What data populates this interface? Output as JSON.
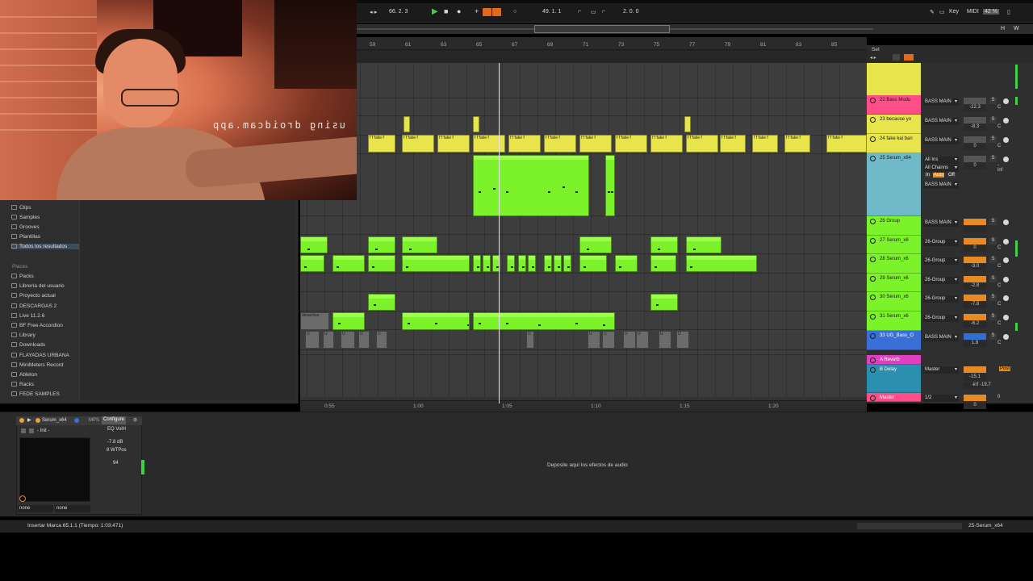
{
  "webcam": {
    "overlay_text": "using droidcam.app"
  },
  "transport": {
    "tempo": "66. 2. 3",
    "position": "49. 1. 1",
    "loop_length": "2. 0. 0",
    "key_label": "Key",
    "midi_label": "MIDI",
    "cpu": "42 %",
    "hw_label": "H",
    "w_label": "W",
    "set_label": "Set"
  },
  "ruler": {
    "bars": [
      "59",
      "61",
      "63",
      "65",
      "67",
      "69",
      "71",
      "73",
      "75",
      "77",
      "79",
      "81",
      "83",
      "85"
    ]
  },
  "time_ruler": {
    "labels": [
      "0:55",
      "1:00",
      "1:05",
      "1:10",
      "1:15",
      "1:20"
    ]
  },
  "browser": {
    "categories": [
      "Clips",
      "Samples",
      "Grooves",
      "Plantillas",
      "Todos los resultados"
    ],
    "places_header": "Places",
    "places": [
      "Packs",
      "Librería del usuario",
      "Proyecto actual",
      "DESCARGAS 2",
      "Live 11.2.6",
      "BF Free Accordion",
      "Library",
      "Downloads",
      "FLAYADAS URBANA",
      "MiniMeters Record",
      "Ableton",
      "Racks",
      "FEDE SAMPLES"
    ]
  },
  "arrangement": {
    "yellow_clip_label": "f f fake f",
    "gray_clip_label": "desactiva",
    "gray_clip_short": "U"
  },
  "tracks": [
    {
      "name": "22 Bass Modu",
      "color": "#ff4d8a",
      "io": "BASS MAIN",
      "vol": "-22.3",
      "pan": "C"
    },
    {
      "name": "23 because yo",
      "color": "#e8e54c",
      "io": "BASS MAIN",
      "vol": "-8.3",
      "pan": "C"
    },
    {
      "name": "24 fake kai ban",
      "color": "#e8e54c",
      "io": "BASS MAIN",
      "vol": "0",
      "pan": "C"
    },
    {
      "name": "25 Serum_x64",
      "color": "#6fb9c9",
      "io": "All Ins",
      "io2": "All Channs",
      "io3": "BASS MAIN",
      "monitor_in": "In",
      "monitor_auto": "Auto",
      "monitor_off": "Off",
      "vol": "0",
      "vol2": "-inf",
      "pan": "-inf"
    },
    {
      "name": "26 Group",
      "color": "#7cf22a",
      "io": "BASS MAIN",
      "vol": "",
      "pan": ""
    },
    {
      "name": "27 Serum_x6",
      "color": "#7cf22a",
      "io": "26-Group",
      "vol": "0",
      "pan": "C"
    },
    {
      "name": "28 Serum_x6",
      "color": "#7cf22a",
      "io": "26-Group",
      "vol": "-3.0",
      "pan": "C"
    },
    {
      "name": "29 Serum_x6",
      "color": "#7cf22a",
      "io": "26-Group",
      "vol": "-2.8",
      "pan": "C"
    },
    {
      "name": "30 Serum_x6",
      "color": "#7cf22a",
      "io": "26-Group",
      "vol": "-7.8",
      "pan": "C"
    },
    {
      "name": "31 Serum_x6",
      "color": "#7cf22a",
      "io": "26-Group",
      "vol": "-6.2",
      "pan": "C"
    },
    {
      "name": "33 UG_Bass_O",
      "color": "#3a6fd8",
      "io": "BASS MAIN",
      "vol": "1.8",
      "pan": "C"
    }
  ],
  "returns": [
    {
      "name": "A Reverb",
      "color": "#e040c0"
    },
    {
      "name": "B Delay",
      "color": "#2b8fb0",
      "io": "Master",
      "vol": "-15.1",
      "vol2": "-inf",
      "vol3": "-19.7",
      "post": "Post"
    },
    {
      "name": "Master",
      "color": "#ff4d8a",
      "io": "1/2",
      "vol": "0",
      "pan": "0"
    }
  ],
  "device": {
    "name": "Serum_x64",
    "configure_label": "Configure",
    "preset": "- Init -",
    "param1_name": "EQ VolH",
    "param1_value": "-7.8 dB",
    "param2_name": "8 WTPos",
    "param2_value": "94",
    "route1": "none",
    "route2": "none",
    "mps": "MPS",
    "drop_text": "Deposite aquí los efectos de audio"
  },
  "status": {
    "message": "Insertar Marca 65.1.1 (Tiempo: 1:03:471)",
    "track": "25-Serum_x64"
  }
}
